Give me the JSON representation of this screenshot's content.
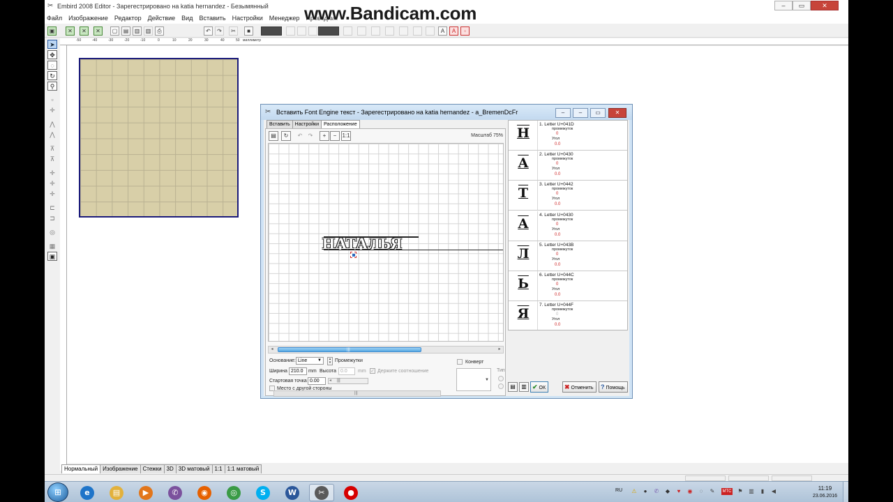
{
  "app": {
    "title": "Embird 2008 Editor - Зарегестрировано на katia hernandez - Безымянный",
    "window_buttons": [
      "–",
      "▭",
      "✕"
    ]
  },
  "watermark": "www.Bandicam.com",
  "menu": [
    "Файл",
    "Изображение",
    "Редактор",
    "Действие",
    "Вид",
    "Вставить",
    "Настройки",
    "Менеджер",
    "Проводник"
  ],
  "ruler": {
    "ticks": [
      "-50",
      "-40",
      "-30",
      "-20",
      "-10",
      "0",
      "10",
      "20",
      "30",
      "40",
      "50"
    ],
    "unit": "миллиметр"
  },
  "view_tabs": [
    "Нормальный",
    "Изображение",
    "Стежки",
    "3D",
    "3D матовый",
    "1:1",
    "1:1 матовый"
  ],
  "dialog": {
    "title": "Вставить Font Engine  текст - Зарегестрировано на katia hernandez - a_BremenDcFr",
    "tabs": [
      "Вставить",
      "Настройки",
      "Расположение"
    ],
    "zoom": "Масштаб 75%",
    "preview_text": "НАТАЛЬЯ",
    "controls": {
      "base_label": "Основание:",
      "base_value": "Line",
      "spacing_label": "Промежутки",
      "width_label": "Ширина",
      "width_value": "210.0",
      "width_unit": "mm",
      "height_label": "Высота",
      "height_value": "0.0",
      "height_unit": "mm",
      "keep_ratio_label": "Держите соотношение",
      "start_label": "Стартовая точка",
      "start_value": "0.00",
      "other_side_label": "Место с другой стороны",
      "envelope_label": "Конверт",
      "type_label": "Тип"
    },
    "letters": [
      {
        "glyph": "Н",
        "name": "1. Letter U+041D",
        "spacing_label": "промежуток",
        "spacing": "0",
        "angle_label": "Угол",
        "angle": "0.0"
      },
      {
        "glyph": "А",
        "name": "2. Letter U+0430",
        "spacing_label": "промежуток",
        "spacing": "0",
        "angle_label": "Угол",
        "angle": "0.0"
      },
      {
        "glyph": "Т",
        "name": "3. Letter U+0442",
        "spacing_label": "промежуток",
        "spacing": "0",
        "angle_label": "Угол",
        "angle": "0.0"
      },
      {
        "glyph": "А",
        "name": "4. Letter U+0430",
        "spacing_label": "промежуток",
        "spacing": "0",
        "angle_label": "Угол",
        "angle": "0.0"
      },
      {
        "glyph": "Л",
        "name": "5. Letter U+043B",
        "spacing_label": "промежуток",
        "spacing": "0",
        "angle_label": "Угол",
        "angle": "0.0"
      },
      {
        "glyph": "Ь",
        "name": "6. Letter U+044C",
        "spacing_label": "промежуток",
        "spacing": "0",
        "angle_label": "Угол",
        "angle": "0.0"
      },
      {
        "glyph": "Я",
        "name": "7. Letter U+044F",
        "spacing_label": "промежуток",
        "spacing": "0",
        "angle_label": "Угол",
        "angle": "0.0"
      }
    ],
    "buttons": {
      "ok": "ОК",
      "cancel": "Отменить",
      "help": "Помощь"
    }
  },
  "taskbar": {
    "apps": [
      {
        "icon": "internet-explorer-icon",
        "glyph": "e",
        "color": "#1e74c9"
      },
      {
        "icon": "file-explorer-icon",
        "glyph": "▤",
        "color": "#e2b13c"
      },
      {
        "icon": "media-player-icon",
        "glyph": "▶",
        "color": "#e2761b"
      },
      {
        "icon": "viber-icon",
        "glyph": "✆",
        "color": "#7b519d"
      },
      {
        "icon": "firefox-icon",
        "glyph": "◉",
        "color": "#e66000"
      },
      {
        "icon": "chrome-icon",
        "glyph": "◎",
        "color": "#3a9b45"
      },
      {
        "icon": "skype-icon",
        "glyph": "S",
        "color": "#00aff0"
      },
      {
        "icon": "word-icon",
        "glyph": "W",
        "color": "#2b579a"
      },
      {
        "icon": "embird-icon",
        "glyph": "✂",
        "color": "#5a5a5a"
      },
      {
        "icon": "bandicam-record-icon",
        "glyph": "●",
        "color": "#d60000"
      }
    ],
    "language": "RU",
    "time": "11:19",
    "date": "23.06.2016"
  }
}
